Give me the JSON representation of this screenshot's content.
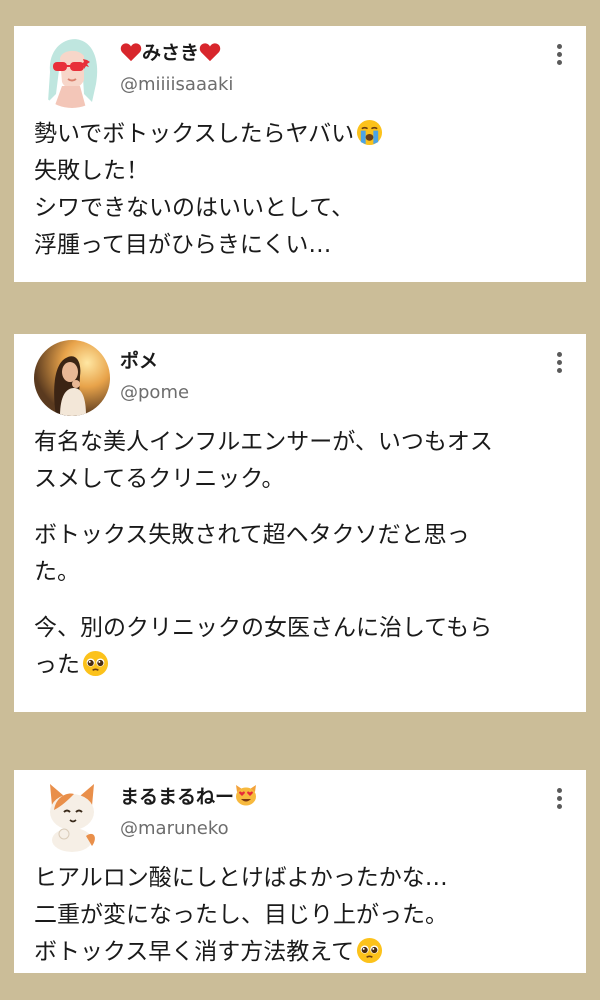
{
  "posts": [
    {
      "name_prefix_icon": "heart-icon",
      "name": "みさき",
      "name_suffix_icon": "heart-icon",
      "handle": "@miiiisaaaki",
      "avatar_icon": "girl-sunglasses-avatar",
      "text_lines": [
        [
          "勢いでボトックスしたらヤバい"
        ],
        [
          "失敗した！"
        ],
        [
          "シワできないのはいいとして、"
        ],
        [
          "浮腫って目がひらきにくい…"
        ]
      ],
      "text_emoji": "crying-face-emoji"
    },
    {
      "name": "ポメ",
      "handle": "@pome",
      "avatar_icon": "woman-photo-avatar",
      "paragraphs": [
        [
          "有名な美人インフルエンサーが、いつもオス",
          "スメしてるクリニック。"
        ],
        [
          "ボトックス失敗されて超ヘタクソだと思っ",
          "た。"
        ],
        [
          "今、別のクリニックの女医さんに治してもら",
          "った"
        ]
      ],
      "text_emoji": "pleading-face-emoji"
    },
    {
      "name": "まるまるねー",
      "name_suffix_icon": "heart-eyes-cat-emoji",
      "handle": "@maruneko",
      "avatar_icon": "cat-avatar",
      "text_lines": [
        [
          "ヒアルロン酸にしとけばよかったかな…"
        ],
        [
          "二重が変になったし、目じり上がった。"
        ],
        [
          "ボトックス早く消す方法教えて"
        ]
      ],
      "text_emoji": "pleading-face-emoji"
    }
  ],
  "colors": {
    "background": "#cbbd98",
    "card": "#ffffff",
    "text": "#1a1a1a",
    "handle": "#6d6d6d",
    "heart": "#d8262c"
  }
}
